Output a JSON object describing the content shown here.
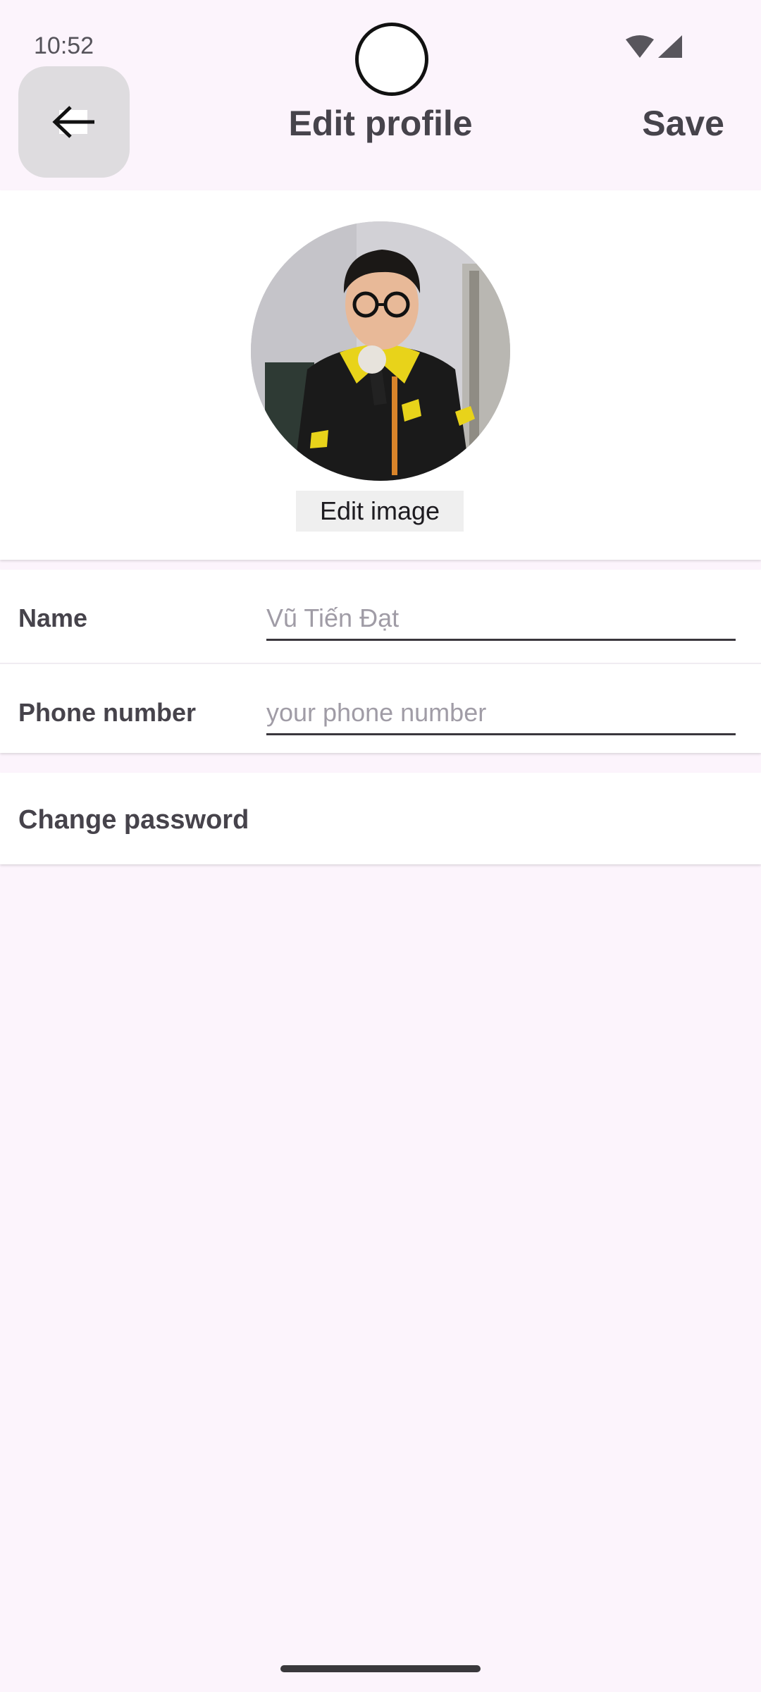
{
  "status_bar": {
    "time": "10:52"
  },
  "header": {
    "title": "Edit profile",
    "save_label": "Save"
  },
  "profile": {
    "edit_image_label": "Edit image"
  },
  "form": {
    "name": {
      "label": "Name",
      "placeholder": "Vũ Tiến Đạt"
    },
    "phone": {
      "label": "Phone number",
      "placeholder": "your phone number"
    }
  },
  "change_password_label": "Change password",
  "icons": {
    "back": "arrow-left-icon",
    "wifi": "wifi-icon",
    "signal": "signal-icon"
  }
}
